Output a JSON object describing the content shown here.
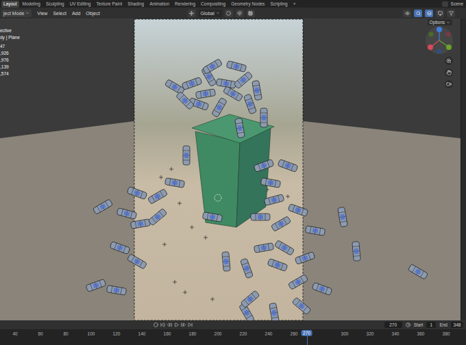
{
  "menu_bar": {
    "tabs": [
      {
        "label": "Layout",
        "selected": true
      },
      {
        "label": "Modeling",
        "selected": false
      },
      {
        "label": "Sculpting",
        "selected": false
      },
      {
        "label": "UV Editing",
        "selected": false
      },
      {
        "label": "Texture Paint",
        "selected": false
      },
      {
        "label": "Shading",
        "selected": false
      },
      {
        "label": "Animation",
        "selected": false
      },
      {
        "label": "Rendering",
        "selected": false
      },
      {
        "label": "Compositing",
        "selected": false
      },
      {
        "label": "Geometry Nodes",
        "selected": false
      },
      {
        "label": "Scripting",
        "selected": false
      }
    ],
    "add_tab": "+",
    "scene": "Scene"
  },
  "header": {
    "mode": "ject Mode",
    "menus": [
      "View",
      "Select",
      "Add",
      "Object"
    ],
    "transform": "Global",
    "options": "Options"
  },
  "viewport": {
    "stats": [
      "ective",
      "dy | Plane",
      "47",
      ",926",
      ",976",
      ",139",
      ",574"
    ]
  },
  "timeline": {
    "current_frame": "270",
    "start_label": "Start",
    "start": "1",
    "end_label": "End",
    "end": "348",
    "ticks": [
      "40",
      "60",
      "80",
      "100",
      "120",
      "140",
      "160",
      "180",
      "200",
      "220",
      "240",
      "260",
      "300",
      "320",
      "340",
      "360",
      "380"
    ],
    "playhead": "270"
  }
}
